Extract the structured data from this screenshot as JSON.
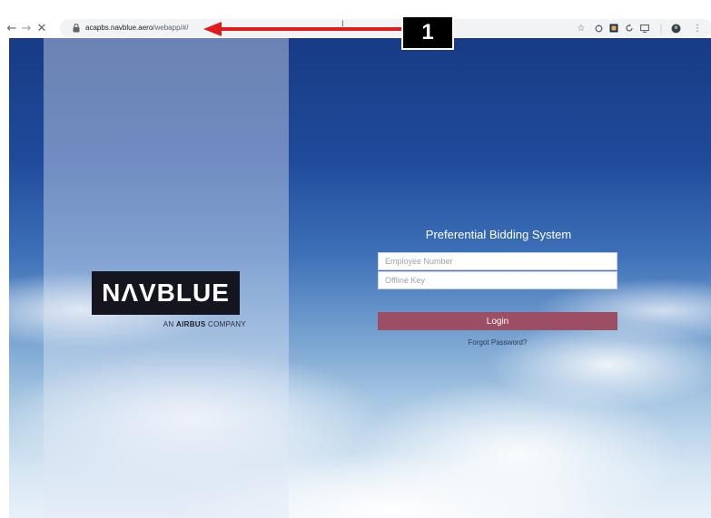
{
  "browser": {
    "url_host": "acapbs.navblue.aero",
    "url_path": "/webapp/#/",
    "cursor_glyph": "I",
    "icons": [
      "back-arrow-icon",
      "forward-arrow-icon",
      "stop-loading-icon",
      "lock-icon",
      "star-icon",
      "extension-circle-icon",
      "extension-square-icon",
      "extension-reload-icon",
      "cast-icon",
      "profile-icon",
      "menu-dots-icon"
    ]
  },
  "brand": {
    "logo_text": "NΛVBLUE",
    "tagline_prefix": "AN ",
    "tagline_bold": "AIRBUS",
    "tagline_suffix": " COMPANY"
  },
  "form": {
    "title": "Preferential Bidding System",
    "employee_placeholder": "Employee Number",
    "offline_key_placeholder": "Offline Key",
    "login_label": "Login",
    "forgot_label": "Forgot Password?"
  },
  "annotation": {
    "badge_label": "1",
    "arrow_color": "#e01b1b"
  },
  "colors": {
    "login_button": "#9b4e64",
    "logo_background": "#15151f",
    "sky_top": "#183b85"
  }
}
